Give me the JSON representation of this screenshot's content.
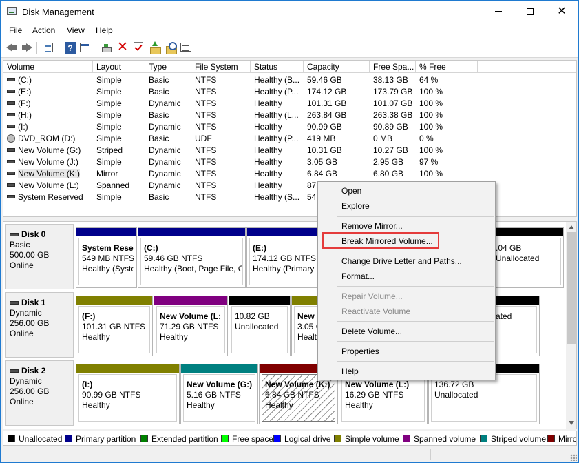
{
  "window": {
    "title": "Disk Management"
  },
  "menu": {
    "file": "File",
    "action": "Action",
    "view": "View",
    "help": "Help"
  },
  "toolbar": {
    "icons": [
      "back-icon",
      "forward-icon",
      "console-tree-icon",
      "help-icon",
      "panel-icon",
      "connect-icon",
      "delete-icon",
      "check-icon",
      "folder-up-icon",
      "search-icon",
      "properties-icon"
    ]
  },
  "volume_list": {
    "columns": [
      "Volume",
      "Layout",
      "Type",
      "File System",
      "Status",
      "Capacity",
      "Free Spa...",
      "% Free"
    ],
    "rows": [
      {
        "volume": "(C:)",
        "layout": "Simple",
        "type": "Basic",
        "fs": "NTFS",
        "status": "Healthy (B...",
        "capacity": "59.46 GB",
        "free": "38.13 GB",
        "pct": "64 %"
      },
      {
        "volume": "(E:)",
        "layout": "Simple",
        "type": "Basic",
        "fs": "NTFS",
        "status": "Healthy (P...",
        "capacity": "174.12 GB",
        "free": "173.79 GB",
        "pct": "100 %"
      },
      {
        "volume": "(F:)",
        "layout": "Simple",
        "type": "Dynamic",
        "fs": "NTFS",
        "status": "Healthy",
        "capacity": "101.31 GB",
        "free": "101.07 GB",
        "pct": "100 %"
      },
      {
        "volume": "(H:)",
        "layout": "Simple",
        "type": "Basic",
        "fs": "NTFS",
        "status": "Healthy (L...",
        "capacity": "263.84 GB",
        "free": "263.38 GB",
        "pct": "100 %"
      },
      {
        "volume": "(I:)",
        "layout": "Simple",
        "type": "Dynamic",
        "fs": "NTFS",
        "status": "Healthy",
        "capacity": "90.99 GB",
        "free": "90.89 GB",
        "pct": "100 %"
      },
      {
        "volume": "DVD_ROM (D:)",
        "layout": "Simple",
        "type": "Basic",
        "fs": "UDF",
        "status": "Healthy (P...",
        "capacity": "419 MB",
        "free": "0 MB",
        "pct": "0 %"
      },
      {
        "volume": "New Volume (G:)",
        "layout": "Striped",
        "type": "Dynamic",
        "fs": "NTFS",
        "status": "Healthy",
        "capacity": "10.31 GB",
        "free": "10.27 GB",
        "pct": "100 %"
      },
      {
        "volume": "New Volume (J:)",
        "layout": "Simple",
        "type": "Dynamic",
        "fs": "NTFS",
        "status": "Healthy",
        "capacity": "3.05 GB",
        "free": "2.95 GB",
        "pct": "97 %"
      },
      {
        "volume": "New Volume (K:)",
        "layout": "Mirror",
        "type": "Dynamic",
        "fs": "NTFS",
        "status": "Healthy",
        "capacity": "6.84 GB",
        "free": "6.80 GB",
        "pct": "100 %"
      },
      {
        "volume": "New Volume (L:)",
        "layout": "Spanned",
        "type": "Dynamic",
        "fs": "NTFS",
        "status": "Healthy",
        "capacity": "87.",
        "free": "",
        "pct": ""
      },
      {
        "volume": "System Reserved",
        "layout": "Simple",
        "type": "Basic",
        "fs": "NTFS",
        "status": "Healthy (S...",
        "capacity": "549",
        "free": "",
        "pct": ""
      }
    ]
  },
  "disks": [
    {
      "name": "Disk 0",
      "type": "Basic",
      "size": "500.00 GB",
      "state": "Online",
      "partitions": [
        {
          "title": "System Reser",
          "line2": "549 MB NTFS",
          "line3": "Healthy (Syste",
          "bar": "#00008b"
        },
        {
          "title": "(C:)",
          "line2": "59.46 GB NTFS",
          "line3": "Healthy (Boot, Page File, C",
          "bar": "#00008b"
        },
        {
          "title": "(E:)",
          "line2": "174.12 GB NTFS",
          "line3": "Healthy (Primary P",
          "bar": "#00008b"
        },
        {
          "title": "",
          "line2": ".04 GB",
          "line3": "Unallocated",
          "bar": "#000000"
        }
      ]
    },
    {
      "name": "Disk 1",
      "type": "Dynamic",
      "size": "256.00 GB",
      "state": "Online",
      "partitions": [
        {
          "title": "(F:)",
          "line2": "101.31 GB NTFS",
          "line3": "Healthy",
          "bar": "#808000"
        },
        {
          "title": "New Volume  (L:",
          "line2": "71.29 GB NTFS",
          "line3": "Healthy",
          "bar": "#800080"
        },
        {
          "title": "",
          "line2": "10.82 GB",
          "line3": "Unallocated",
          "bar": "#000000"
        },
        {
          "title": "New V",
          "line2": "3.05 G",
          "line3": "Healt",
          "bar": "#808000"
        },
        {
          "title": "",
          "line2": "",
          "line3": "ated",
          "bar": "#000000"
        }
      ]
    },
    {
      "name": "Disk 2",
      "type": "Dynamic",
      "size": "256.00 GB",
      "state": "Online",
      "partitions": [
        {
          "title": "(I:)",
          "line2": "90.99 GB NTFS",
          "line3": "Healthy",
          "bar": "#808000"
        },
        {
          "title": "New Volume  (G:)",
          "line2": "5.16 GB NTFS",
          "line3": "Healthy",
          "bar": "#008080"
        },
        {
          "title": "New Volume  (K:)",
          "line2": "6.84 GB NTFS",
          "line3": "Healthy",
          "bar": "#800000"
        },
        {
          "title": "New Volume  (L:)",
          "line2": "16.29 GB NTFS",
          "line3": "Healthy",
          "bar": "#800080"
        },
        {
          "title": "",
          "line2": "136.72 GB",
          "line3": "Unallocated",
          "bar": "#000000"
        }
      ]
    }
  ],
  "legend": [
    {
      "label": "Unallocated",
      "color": "#000000"
    },
    {
      "label": "Primary partition",
      "color": "#00008b"
    },
    {
      "label": "Extended partition",
      "color": "#008000"
    },
    {
      "label": "Free space",
      "color": "#00ff00"
    },
    {
      "label": "Logical drive",
      "color": "#0000ff"
    },
    {
      "label": "Simple volume",
      "color": "#808000"
    },
    {
      "label": "Spanned volume",
      "color": "#800080"
    },
    {
      "label": "Striped volume",
      "color": "#008080"
    },
    {
      "label": "Mirro",
      "color": "#800000"
    }
  ],
  "context_menu": {
    "open": "Open",
    "explore": "Explore",
    "remove_mirror": "Remove Mirror...",
    "break_mirrored": "Break Mirrored Volume...",
    "change_letter": "Change Drive Letter and Paths...",
    "format": "Format...",
    "repair": "Repair Volume...",
    "reactivate": "Reactivate Volume",
    "delete": "Delete Volume...",
    "properties": "Properties",
    "help": "Help"
  },
  "colors": {
    "highlight": "#e43b3b",
    "primary": "#00008b",
    "simple": "#808000"
  }
}
